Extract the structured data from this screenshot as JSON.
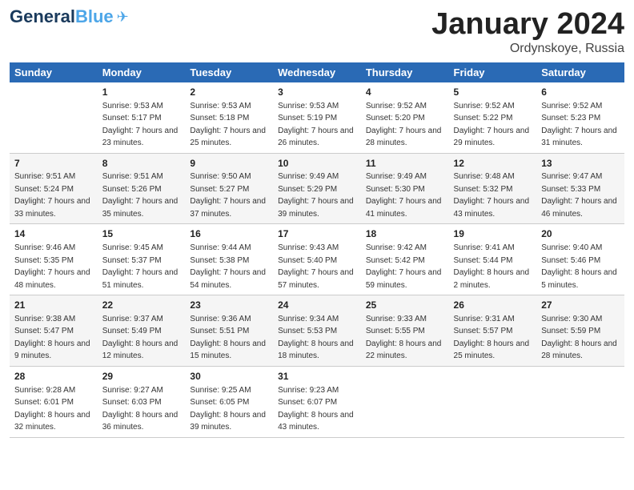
{
  "header": {
    "logo_general": "General",
    "logo_blue": "Blue",
    "title": "January 2024",
    "location": "Ordynskoye, Russia"
  },
  "days_of_week": [
    "Sunday",
    "Monday",
    "Tuesday",
    "Wednesday",
    "Thursday",
    "Friday",
    "Saturday"
  ],
  "weeks": [
    [
      {
        "num": "",
        "sunrise": "",
        "sunset": "",
        "daylight": ""
      },
      {
        "num": "1",
        "sunrise": "Sunrise: 9:53 AM",
        "sunset": "Sunset: 5:17 PM",
        "daylight": "Daylight: 7 hours and 23 minutes."
      },
      {
        "num": "2",
        "sunrise": "Sunrise: 9:53 AM",
        "sunset": "Sunset: 5:18 PM",
        "daylight": "Daylight: 7 hours and 25 minutes."
      },
      {
        "num": "3",
        "sunrise": "Sunrise: 9:53 AM",
        "sunset": "Sunset: 5:19 PM",
        "daylight": "Daylight: 7 hours and 26 minutes."
      },
      {
        "num": "4",
        "sunrise": "Sunrise: 9:52 AM",
        "sunset": "Sunset: 5:20 PM",
        "daylight": "Daylight: 7 hours and 28 minutes."
      },
      {
        "num": "5",
        "sunrise": "Sunrise: 9:52 AM",
        "sunset": "Sunset: 5:22 PM",
        "daylight": "Daylight: 7 hours and 29 minutes."
      },
      {
        "num": "6",
        "sunrise": "Sunrise: 9:52 AM",
        "sunset": "Sunset: 5:23 PM",
        "daylight": "Daylight: 7 hours and 31 minutes."
      }
    ],
    [
      {
        "num": "7",
        "sunrise": "Sunrise: 9:51 AM",
        "sunset": "Sunset: 5:24 PM",
        "daylight": "Daylight: 7 hours and 33 minutes."
      },
      {
        "num": "8",
        "sunrise": "Sunrise: 9:51 AM",
        "sunset": "Sunset: 5:26 PM",
        "daylight": "Daylight: 7 hours and 35 minutes."
      },
      {
        "num": "9",
        "sunrise": "Sunrise: 9:50 AM",
        "sunset": "Sunset: 5:27 PM",
        "daylight": "Daylight: 7 hours and 37 minutes."
      },
      {
        "num": "10",
        "sunrise": "Sunrise: 9:49 AM",
        "sunset": "Sunset: 5:29 PM",
        "daylight": "Daylight: 7 hours and 39 minutes."
      },
      {
        "num": "11",
        "sunrise": "Sunrise: 9:49 AM",
        "sunset": "Sunset: 5:30 PM",
        "daylight": "Daylight: 7 hours and 41 minutes."
      },
      {
        "num": "12",
        "sunrise": "Sunrise: 9:48 AM",
        "sunset": "Sunset: 5:32 PM",
        "daylight": "Daylight: 7 hours and 43 minutes."
      },
      {
        "num": "13",
        "sunrise": "Sunrise: 9:47 AM",
        "sunset": "Sunset: 5:33 PM",
        "daylight": "Daylight: 7 hours and 46 minutes."
      }
    ],
    [
      {
        "num": "14",
        "sunrise": "Sunrise: 9:46 AM",
        "sunset": "Sunset: 5:35 PM",
        "daylight": "Daylight: 7 hours and 48 minutes."
      },
      {
        "num": "15",
        "sunrise": "Sunrise: 9:45 AM",
        "sunset": "Sunset: 5:37 PM",
        "daylight": "Daylight: 7 hours and 51 minutes."
      },
      {
        "num": "16",
        "sunrise": "Sunrise: 9:44 AM",
        "sunset": "Sunset: 5:38 PM",
        "daylight": "Daylight: 7 hours and 54 minutes."
      },
      {
        "num": "17",
        "sunrise": "Sunrise: 9:43 AM",
        "sunset": "Sunset: 5:40 PM",
        "daylight": "Daylight: 7 hours and 57 minutes."
      },
      {
        "num": "18",
        "sunrise": "Sunrise: 9:42 AM",
        "sunset": "Sunset: 5:42 PM",
        "daylight": "Daylight: 7 hours and 59 minutes."
      },
      {
        "num": "19",
        "sunrise": "Sunrise: 9:41 AM",
        "sunset": "Sunset: 5:44 PM",
        "daylight": "Daylight: 8 hours and 2 minutes."
      },
      {
        "num": "20",
        "sunrise": "Sunrise: 9:40 AM",
        "sunset": "Sunset: 5:46 PM",
        "daylight": "Daylight: 8 hours and 5 minutes."
      }
    ],
    [
      {
        "num": "21",
        "sunrise": "Sunrise: 9:38 AM",
        "sunset": "Sunset: 5:47 PM",
        "daylight": "Daylight: 8 hours and 9 minutes."
      },
      {
        "num": "22",
        "sunrise": "Sunrise: 9:37 AM",
        "sunset": "Sunset: 5:49 PM",
        "daylight": "Daylight: 8 hours and 12 minutes."
      },
      {
        "num": "23",
        "sunrise": "Sunrise: 9:36 AM",
        "sunset": "Sunset: 5:51 PM",
        "daylight": "Daylight: 8 hours and 15 minutes."
      },
      {
        "num": "24",
        "sunrise": "Sunrise: 9:34 AM",
        "sunset": "Sunset: 5:53 PM",
        "daylight": "Daylight: 8 hours and 18 minutes."
      },
      {
        "num": "25",
        "sunrise": "Sunrise: 9:33 AM",
        "sunset": "Sunset: 5:55 PM",
        "daylight": "Daylight: 8 hours and 22 minutes."
      },
      {
        "num": "26",
        "sunrise": "Sunrise: 9:31 AM",
        "sunset": "Sunset: 5:57 PM",
        "daylight": "Daylight: 8 hours and 25 minutes."
      },
      {
        "num": "27",
        "sunrise": "Sunrise: 9:30 AM",
        "sunset": "Sunset: 5:59 PM",
        "daylight": "Daylight: 8 hours and 28 minutes."
      }
    ],
    [
      {
        "num": "28",
        "sunrise": "Sunrise: 9:28 AM",
        "sunset": "Sunset: 6:01 PM",
        "daylight": "Daylight: 8 hours and 32 minutes."
      },
      {
        "num": "29",
        "sunrise": "Sunrise: 9:27 AM",
        "sunset": "Sunset: 6:03 PM",
        "daylight": "Daylight: 8 hours and 36 minutes."
      },
      {
        "num": "30",
        "sunrise": "Sunrise: 9:25 AM",
        "sunset": "Sunset: 6:05 PM",
        "daylight": "Daylight: 8 hours and 39 minutes."
      },
      {
        "num": "31",
        "sunrise": "Sunrise: 9:23 AM",
        "sunset": "Sunset: 6:07 PM",
        "daylight": "Daylight: 8 hours and 43 minutes."
      },
      {
        "num": "",
        "sunrise": "",
        "sunset": "",
        "daylight": ""
      },
      {
        "num": "",
        "sunrise": "",
        "sunset": "",
        "daylight": ""
      },
      {
        "num": "",
        "sunrise": "",
        "sunset": "",
        "daylight": ""
      }
    ]
  ]
}
